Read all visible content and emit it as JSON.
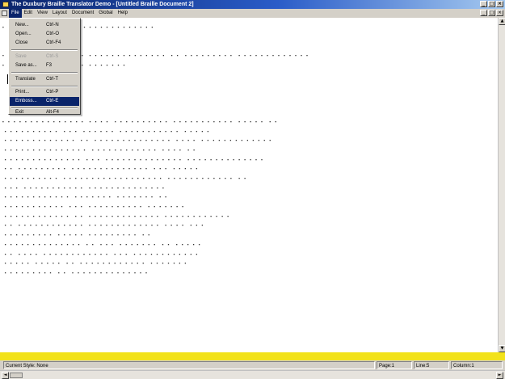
{
  "window": {
    "title": "The Duxbury Braille Translator Demo - [Untitled Braille Document 2]",
    "controls": [
      "_",
      "□",
      "×"
    ]
  },
  "menubar": {
    "items": [
      "File",
      "Edit",
      "View",
      "Layout",
      "Document",
      "Global",
      "Help"
    ],
    "doc_controls": [
      "_",
      "□",
      "×"
    ]
  },
  "file_menu": {
    "items": [
      {
        "label": "New...",
        "shortcut": "Ctrl-N",
        "disabled": false
      },
      {
        "label": "Open...",
        "shortcut": "Ctrl-O",
        "disabled": false
      },
      {
        "label": "Close",
        "shortcut": "Ctrl-F4",
        "disabled": false
      },
      {
        "label": "Save",
        "shortcut": "Ctrl-S",
        "disabled": true
      },
      {
        "label": "Save as...",
        "shortcut": "F3",
        "disabled": false
      },
      {
        "label": "Translate",
        "shortcut": "Ctrl-T",
        "disabled": false
      },
      {
        "label": "Print...",
        "shortcut": "Ctrl-P",
        "disabled": false
      },
      {
        "label": "Emboss...",
        "shortcut": "Ctrl-E",
        "disabled": false
      },
      {
        "label": "Exit",
        "shortcut": "Alt-F4",
        "disabled": false
      }
    ],
    "highlighted": "Emboss..."
  },
  "document": {
    "braille_lines": [
      "⠄⠄⠠⠠⠠⠠⠠⠠⠠⠠⠠⠠⠠⠠⠠⠠⠠⠠⠠⠠⠠⠠⠠⠠⠠⠠⠠",
      "",
      "",
      "⠄⠄⠄⠄⠄⠄⠄⠄⠄⠄⠄⠄⠄⠄⠄⠠⠠⠠⠠⠠⠠⠠⠠⠠⠠⠠⠠⠠⠠ ⠠⠠ ⠠⠠⠠⠠⠠⠠⠠⠠⠠ ⠠⠠⠠⠠⠠⠠⠠⠠⠠⠠⠠⠠⠠",
      "⠄⠄⠄⠄⠄⠄⠄⠄⠄⠄⠄⠄⠄⠄⠄⠠⠠⠠⠠⠠⠠⠠",
      "",
      "",
      "",
      "",
      "",
      "⠄⠄⠄⠄⠄⠄⠄⠄⠄⠄⠄⠄⠄⠄⠄⠠⠠⠠⠠ ⠠⠠⠠⠠⠠⠠⠠⠠⠠⠠ ⠠⠠⠠⠠⠠⠠⠠⠠⠠⠠⠠ ⠠⠠⠠⠠⠠ ⠠⠠",
      "⠠⠠⠠⠠⠠⠠⠠⠠⠠⠠ ⠠⠠⠠ ⠠⠠⠠⠠⠠⠠ ⠠⠠⠠⠠⠠⠠⠠⠠⠠⠠⠠ ⠠⠠⠠⠠⠠",
      "⠠⠠⠠⠠⠠⠠⠠⠠⠠⠠⠠⠠⠠ ⠠⠠ ⠠⠠⠠⠠⠠⠠⠠⠠⠠⠠⠠⠠⠠⠠ ⠠⠠⠠⠠ ⠠⠠⠠⠠⠠⠠⠠⠠⠠⠠⠠⠠⠠",
      "⠠⠠⠠⠠⠠⠠⠠⠠⠠⠠⠠⠠⠠⠠⠠ ⠠⠠⠠⠠⠠⠠⠠⠠⠠⠠⠠⠠ ⠠⠠⠠⠠ ⠠⠠",
      "⠠⠠⠠⠠⠠⠠⠠⠠⠠⠠⠠⠠⠠⠠ ⠠⠠⠠ ⠠⠠⠠⠠⠠⠠⠠⠠⠠⠠⠠⠠⠠⠠ ⠠⠠⠠⠠⠠⠠⠠⠠⠠⠠⠠⠠⠠⠠",
      "⠠⠠ ⠠⠠⠠⠠⠠⠠⠠⠠⠠ ⠠⠠⠠⠠⠠⠠⠠⠠⠠⠠⠠⠠⠠⠠ ⠠⠠⠠ ⠠⠠⠠⠠⠠",
      "⠠⠠⠠⠠⠠⠠⠠⠠⠠⠠ ⠠⠠⠠⠠⠠⠠⠠⠠⠠⠠⠠⠠⠠⠠⠠⠠⠠⠠ ⠠⠠⠠⠠⠠⠠⠠⠠⠠⠠⠠⠠ ⠠⠠",
      "⠠⠠⠠ ⠠⠠⠠⠠⠠⠠⠠⠠⠠⠠⠠ ⠠⠠⠠⠠⠠⠠⠠⠠⠠⠠⠠⠠⠠⠠",
      "⠠⠠⠠⠠⠠⠠⠠⠠⠠⠠⠠⠠ ⠠⠠⠠⠠⠠⠠⠠ ⠠⠠⠠⠠⠠⠠⠠ ⠠⠠",
      "⠠⠠⠠⠠⠠⠠⠠⠠⠠⠠⠠ ⠠⠠⠠ ⠠⠠⠠⠠⠠⠠⠠⠠⠠⠠ ⠠⠠⠠⠠⠠⠠⠠",
      "⠠⠠⠠⠠⠠⠠⠠⠠⠠⠠⠠⠠ ⠠⠠ ⠠⠠⠠⠠⠠⠠⠠⠠⠠⠠⠠⠠⠠ ⠠⠠⠠⠠⠠⠠⠠⠠⠠⠠⠠⠠",
      "⠠⠠ ⠠⠠⠠⠠⠠⠠⠠⠠⠠⠠⠠⠠ ⠠⠠⠠⠠⠠⠠⠠⠠⠠⠠⠠⠠⠠ ⠠⠠⠠⠠ ⠠⠠⠠",
      "⠠⠠⠠⠠⠠⠠⠠⠠⠠ ⠠⠠⠠⠠⠠ ⠠⠠⠠⠠⠠⠠⠠⠠⠠ ⠠⠠",
      "⠠⠠⠠⠠⠠⠠⠠⠠⠠⠠⠠⠠⠠⠠ ⠠⠠ ⠠⠠⠠ ⠠⠠⠠⠠⠠⠠⠠ ⠠⠠ ⠠⠠⠠⠠⠠",
      "⠠⠠ ⠠⠠⠠⠠ ⠠⠠⠠⠠⠠⠠⠠⠠⠠⠠⠠⠠ ⠠⠠⠠ ⠠⠠⠠⠠⠠⠠⠠⠠⠠⠠⠠⠠",
      "⠠⠠⠠⠠⠠ ⠠⠠⠠⠠⠠ ⠠⠠ ⠠⠠⠠⠠⠠⠠⠠⠠⠠⠠⠠⠠ ⠠⠠⠠⠠⠠⠠⠠",
      "⠠⠠⠠⠠⠠⠠⠠⠠⠠ ⠠⠠ ⠠⠠⠠⠠⠠⠠⠠⠠⠠⠠⠠⠠⠠⠠"
    ]
  },
  "statusbar": {
    "style": "Current Style: None",
    "page": "Page:1",
    "line": "Line:5",
    "column": "Column:1"
  },
  "scroll": {
    "left_arrow": "◄",
    "right_arrow": "►",
    "up_arrow": "▲",
    "down_arrow": "▼"
  },
  "colors": {
    "title_bar": "#0a246a",
    "highlight": "#0a246a",
    "yellow_band": "#f2e21a",
    "chrome": "#d4d0c8"
  }
}
